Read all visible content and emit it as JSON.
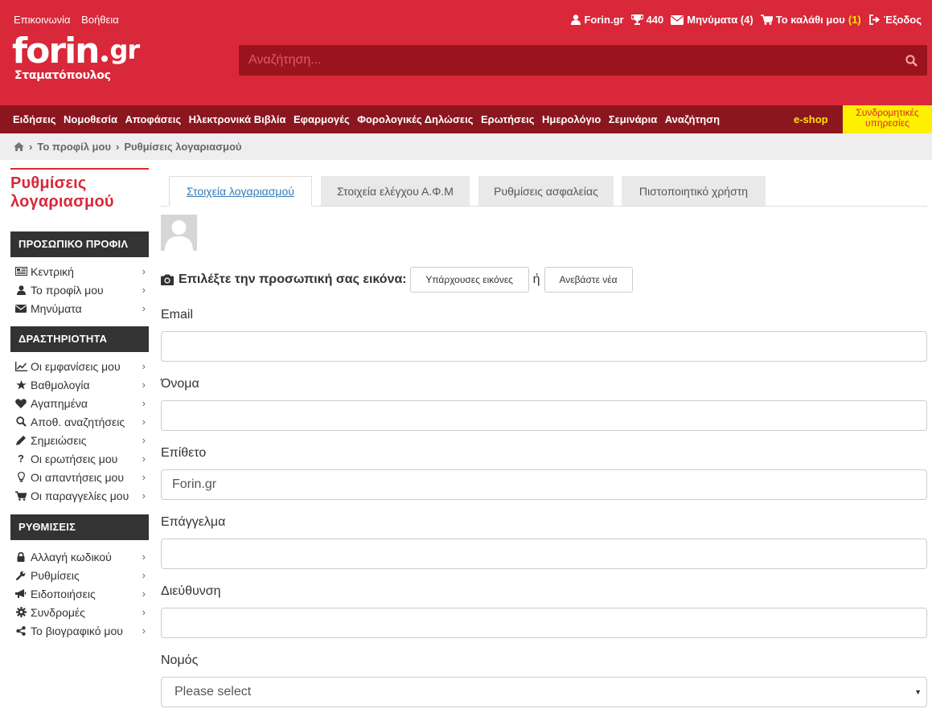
{
  "header": {
    "links": [
      "Επικοινωνία",
      "Βοήθεια"
    ],
    "user": {
      "username": "Forin.gr",
      "points": "440",
      "messages": "Μηνύματα (4)",
      "cart": "Το καλάθι μου",
      "cart_count": "(1)",
      "logout": "Έξοδος"
    },
    "logo": {
      "word": "forin",
      "tld": "gr",
      "sub": "Σταματόπουλος"
    },
    "search_placeholder": "Αναζήτηση..."
  },
  "nav": {
    "items": [
      "Ειδήσεις",
      "Νομοθεσία",
      "Αποφάσεις",
      "Ηλεκτρονικά Βιβλία",
      "Εφαρμογές",
      "Φορολογικές Δηλώσεις",
      "Ερωτήσεις",
      "Ημερολόγιο",
      "Σεμινάρια",
      "Αναζήτηση"
    ],
    "eshop": "e-shop",
    "subscriptions": "Συνδρομητικές υπηρεσίες"
  },
  "breadcrumb": [
    "Το προφίλ μου",
    "Ρυθμίσεις λογαριασμού"
  ],
  "sidebar": {
    "title": "Ρυθμίσεις λογαριασμού",
    "sections": [
      {
        "title": "ΠΡΟΣΩΠΙΚΟ ΠΡΟΦΙΛ",
        "items": [
          {
            "label": "Κεντρική",
            "icon": "newspaper-icon"
          },
          {
            "label": "Το προφίλ μου",
            "icon": "user-icon"
          },
          {
            "label": "Μηνύματα",
            "icon": "envelope-icon"
          }
        ]
      },
      {
        "title": "ΔΡΑΣΤΗΡΙΟΤΗΤΑ",
        "items": [
          {
            "label": "Οι εμφανίσεις μου",
            "icon": "line-chart-icon"
          },
          {
            "label": "Βαθμολογία",
            "icon": "star-icon"
          },
          {
            "label": "Αγαπημένα",
            "icon": "heart-icon"
          },
          {
            "label": "Αποθ. αναζητήσεις",
            "icon": "search-icon"
          },
          {
            "label": "Σημειώσεις",
            "icon": "pencil-icon"
          },
          {
            "label": "Οι ερωτήσεις μου",
            "icon": "question-icon"
          },
          {
            "label": "Οι απαντήσεις μου",
            "icon": "lightbulb-icon"
          },
          {
            "label": "Οι παραγγελίες μου",
            "icon": "cart-icon"
          }
        ]
      },
      {
        "title": "ΡΥΘΜΙΣΕΙΣ",
        "items": [
          {
            "label": "Αλλαγή κωδικού",
            "icon": "lock-icon"
          },
          {
            "label": "Ρυθμίσεις",
            "icon": "wrench-icon"
          },
          {
            "label": "Ειδοποιήσεις",
            "icon": "bullhorn-icon"
          },
          {
            "label": "Συνδρομές",
            "icon": "gear-icon"
          },
          {
            "label": "Το βιογραφικό μου",
            "icon": "share-icon"
          }
        ]
      }
    ]
  },
  "tabs": [
    "Στοιχεία λογαριασμού",
    "Στοιχεία ελέγχου Α.Φ.Μ",
    "Ρυθμίσεις ασφαλείας",
    "Πιστοποιητικό χρήστη"
  ],
  "form": {
    "picture_label": "Επιλέξτε την προσωπική σας εικόνα:",
    "existing_images": "Υπάρχουσες εικόνες",
    "or": "ή",
    "upload_new": "Ανεβάστε νέα",
    "fields": [
      {
        "label": "Email",
        "value": ""
      },
      {
        "label": "Όνομα",
        "value": ""
      },
      {
        "label": "Επίθετο",
        "value": "Forin.gr"
      },
      {
        "label": "Επάγγελμα",
        "value": ""
      },
      {
        "label": "Διεύθυνση",
        "value": ""
      }
    ],
    "region": {
      "label": "Νομός",
      "selected": "Please select"
    }
  },
  "colors": {
    "brand": "#d8283a",
    "nav": "#8c1620",
    "search": "#9b141d",
    "highlight": "#ffef00"
  }
}
